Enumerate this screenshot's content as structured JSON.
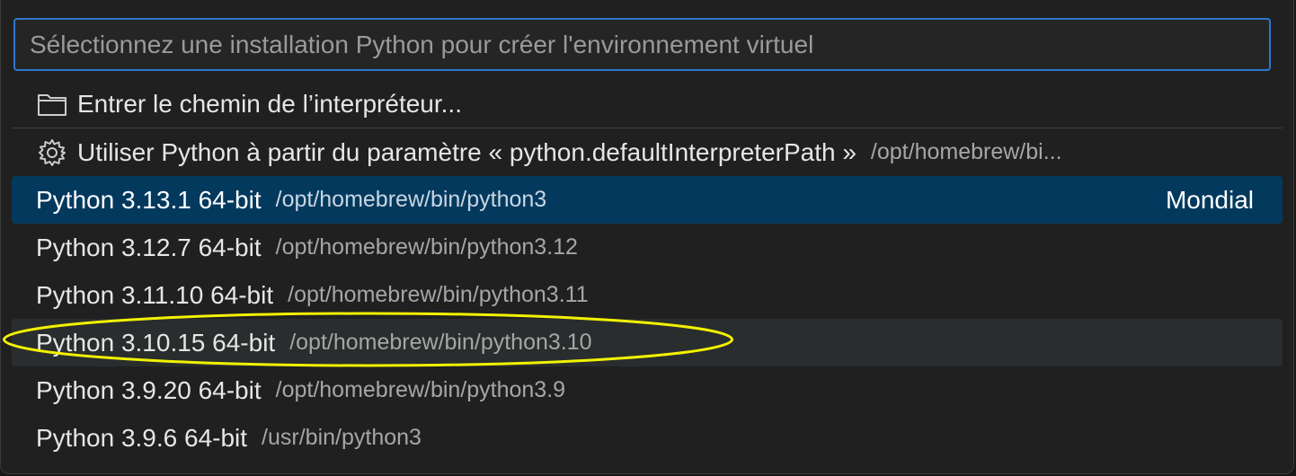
{
  "search": {
    "placeholder": "Sélectionnez une installation Python pour créer l'environnement virtuel",
    "value": ""
  },
  "items": [
    {
      "icon": "folder-icon",
      "label": "Entrer le chemin de l’interpréteur...",
      "description": ""
    },
    {
      "icon": "gear-icon",
      "label": "Utiliser Python à partir du paramètre « python.defaultInterpreterPath »",
      "description": "/opt/homebrew/bi..."
    },
    {
      "label": "Python 3.13.1 64-bit",
      "description": "/opt/homebrew/bin/python3",
      "badge": "Mondial",
      "selected": true
    },
    {
      "label": "Python 3.12.7 64-bit",
      "description": "/opt/homebrew/bin/python3.12"
    },
    {
      "label": "Python 3.11.10 64-bit",
      "description": "/opt/homebrew/bin/python3.11"
    },
    {
      "label": "Python 3.10.15 64-bit",
      "description": "/opt/homebrew/bin/python3.10",
      "hovered": true,
      "annotated": true
    },
    {
      "label": "Python 3.9.20 64-bit",
      "description": "/opt/homebrew/bin/python3.9"
    },
    {
      "label": "Python 3.9.6 64-bit",
      "description": "/usr/bin/python3"
    }
  ],
  "colors": {
    "background": "#202020",
    "focus_border": "#2f77d0",
    "selected_row": "#04395e",
    "hover_row": "#2a2d2e",
    "annotation": "#f2f200"
  }
}
